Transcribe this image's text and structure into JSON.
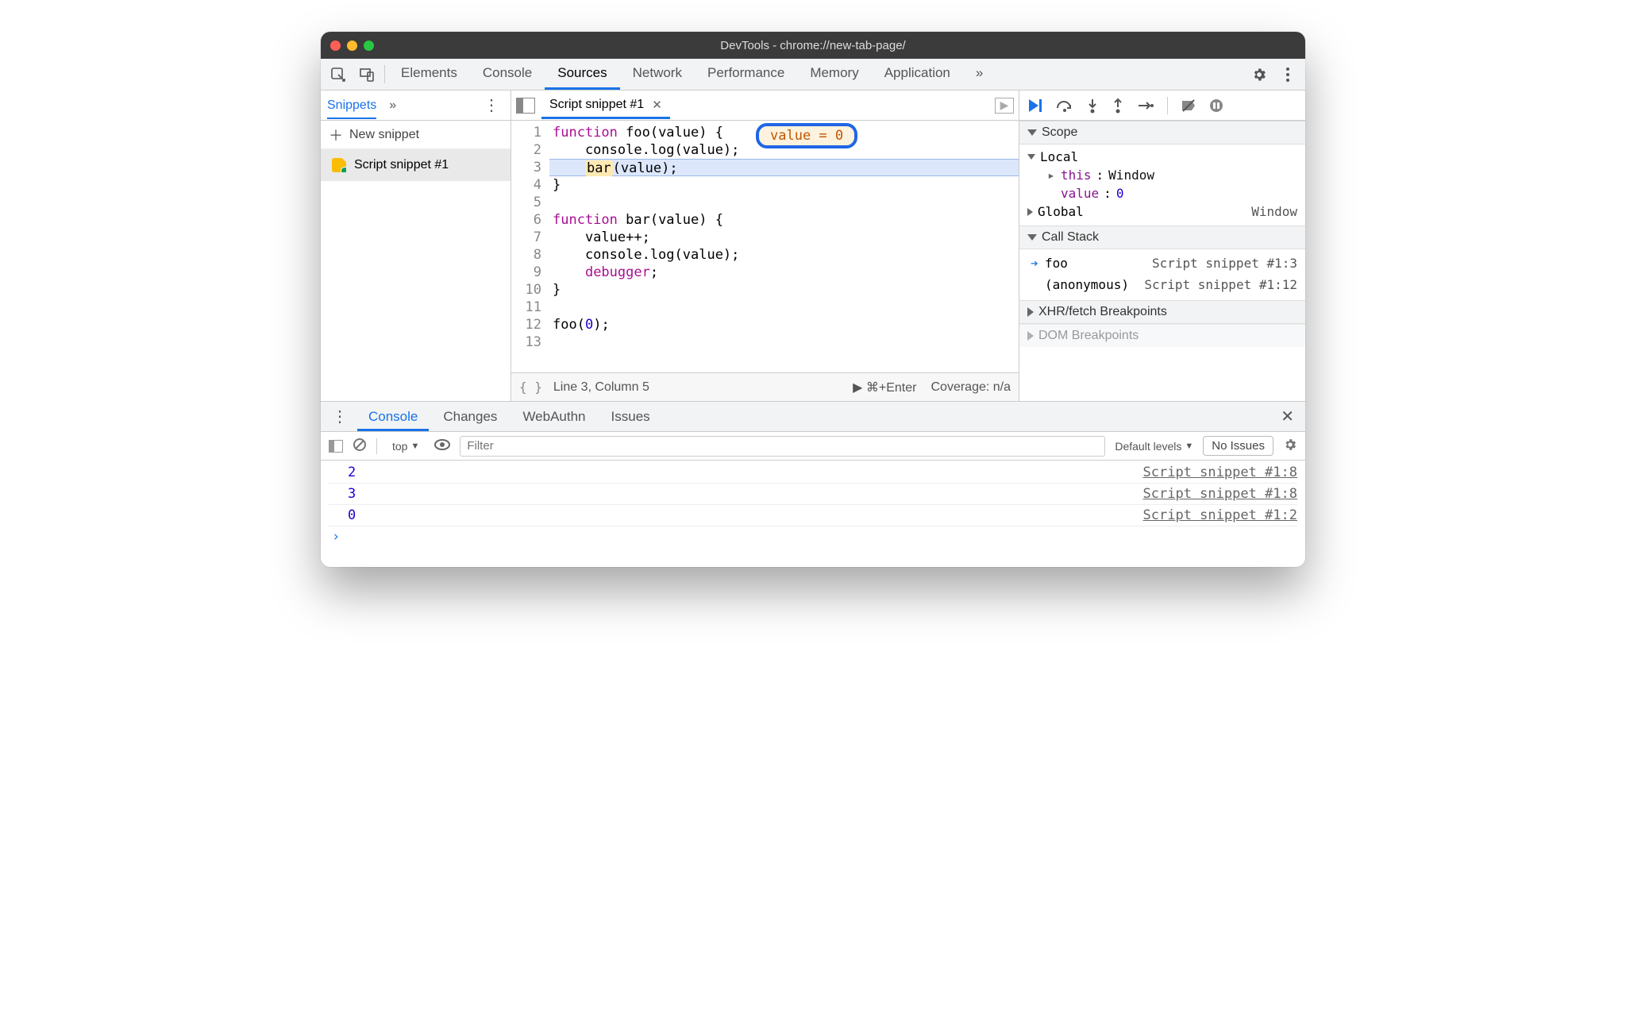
{
  "window": {
    "title": "DevTools - chrome://new-tab-page/"
  },
  "tabs": {
    "items": [
      "Elements",
      "Console",
      "Sources",
      "Network",
      "Performance",
      "Memory",
      "Application"
    ],
    "active": "Sources",
    "overflow": "»"
  },
  "snippets": {
    "header": "Snippets",
    "overflow": "»",
    "new_label": "New snippet",
    "items": [
      {
        "label": "Script snippet #1"
      }
    ]
  },
  "editor": {
    "tab_label": "Script snippet #1",
    "badge": "value = 0",
    "active_line": 3,
    "lines": [
      {
        "n": 1,
        "html": "<span class='kw'>function</span> foo(value) {"
      },
      {
        "n": 2,
        "html": "    console.log(value);"
      },
      {
        "n": 3,
        "html": "    <span class='hi-tok'>bar</span>(value);"
      },
      {
        "n": 4,
        "html": "}"
      },
      {
        "n": 5,
        "html": ""
      },
      {
        "n": 6,
        "html": "<span class='kw'>function</span> bar(value) {"
      },
      {
        "n": 7,
        "html": "    value++;"
      },
      {
        "n": 8,
        "html": "    console.log(value);"
      },
      {
        "n": 9,
        "html": "    <span class='kw'>debugger</span>;"
      },
      {
        "n": 10,
        "html": "}"
      },
      {
        "n": 11,
        "html": ""
      },
      {
        "n": 12,
        "html": "foo(<span class='num'>0</span>);"
      },
      {
        "n": 13,
        "html": ""
      }
    ],
    "status": {
      "pos": "Line 3, Column 5",
      "run": "⌘+Enter",
      "coverage": "Coverage: n/a"
    }
  },
  "scope": {
    "header": "Scope",
    "local_label": "Local",
    "this_label": "this",
    "this_value": "Window",
    "value_label": "value",
    "value_value": "0",
    "global_label": "Global",
    "global_value": "Window"
  },
  "callstack": {
    "header": "Call Stack",
    "frames": [
      {
        "name": "foo",
        "loc": "Script snippet #1:3",
        "current": true
      },
      {
        "name": "(anonymous)",
        "loc": "Script snippet #1:12",
        "current": false
      }
    ]
  },
  "sections": {
    "xhr": "XHR/fetch Breakpoints",
    "dom": "DOM Breakpoints"
  },
  "drawer": {
    "tabs": [
      "Console",
      "Changes",
      "WebAuthn",
      "Issues"
    ],
    "active": "Console",
    "context": "top",
    "filter_placeholder": "Filter",
    "levels": "Default levels",
    "issues": "No Issues",
    "rows": [
      {
        "val": "2",
        "src": "Script snippet #1:8"
      },
      {
        "val": "3",
        "src": "Script snippet #1:8"
      },
      {
        "val": "0",
        "src": "Script snippet #1:2"
      }
    ]
  }
}
